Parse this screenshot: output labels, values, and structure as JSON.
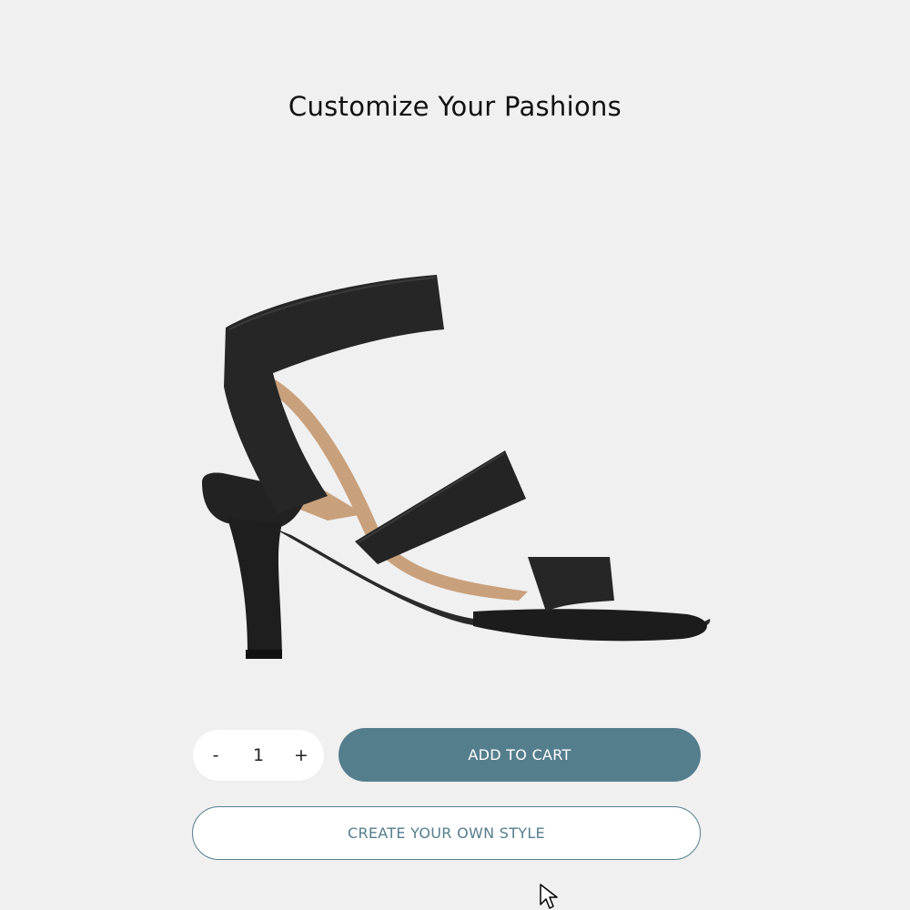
{
  "page": {
    "title": "Customize Your Pashions"
  },
  "product": {
    "image_icon": "sandal-image"
  },
  "quantity": {
    "decrement_label": "-",
    "value": "1",
    "increment_label": "+"
  },
  "actions": {
    "add_to_cart_label": "ADD TO CART",
    "create_style_label": "CREATE YOUR OWN STYLE"
  },
  "colors": {
    "background": "#f0f0f0",
    "accent": "#557e8d",
    "shoe_black": "#1f1f1f",
    "insole_tan": "#c9a07c"
  }
}
